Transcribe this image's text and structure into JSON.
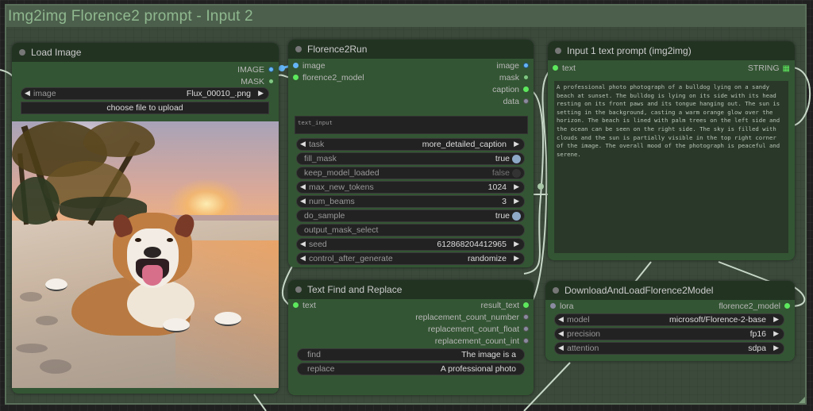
{
  "group": {
    "title": "Img2img Florence2 prompt - Input 2"
  },
  "colors": {
    "node_bg": "#335533",
    "node_header": "#223322",
    "group_bg": "#3b4a3b",
    "group_title": "#8fb88f",
    "slot_image": "#64b5f6",
    "slot_mask": "#81c784",
    "slot_string": "#5de85d",
    "slot_other": "#8a8aa0",
    "wire": "#c8d8c8"
  },
  "load_image": {
    "title": "Load Image",
    "outputs": [
      {
        "name": "IMAGE",
        "type": "image"
      },
      {
        "name": "MASK",
        "type": "mask"
      }
    ],
    "image_widget": {
      "label": "image",
      "value": "Flux_00010_.png"
    },
    "upload_button": "choose file to upload",
    "preview_alt": "bulldog lying on sandy beach at sunset with palm trees"
  },
  "florence2run": {
    "title": "Florence2Run",
    "inputs": [
      {
        "name": "image",
        "type": "image"
      },
      {
        "name": "florence2_model",
        "type": "string"
      }
    ],
    "outputs": [
      {
        "name": "image",
        "type": "image"
      },
      {
        "name": "mask",
        "type": "mask"
      },
      {
        "name": "caption",
        "type": "string"
      },
      {
        "name": "data",
        "type": "other"
      }
    ],
    "text_input_placeholder": "text_input",
    "widgets": {
      "task": {
        "label": "task",
        "value": "more_detailed_caption"
      },
      "fill_mask": {
        "label": "fill_mask",
        "value": "true"
      },
      "keep_model_loaded": {
        "label": "keep_model_loaded",
        "value": "false"
      },
      "max_new_tokens": {
        "label": "max_new_tokens",
        "value": "1024"
      },
      "num_beams": {
        "label": "num_beams",
        "value": "3"
      },
      "do_sample": {
        "label": "do_sample",
        "value": "true"
      },
      "output_mask_select": {
        "label": "output_mask_select",
        "value": ""
      },
      "seed": {
        "label": "seed",
        "value": "612868204412965"
      },
      "control_after_generate": {
        "label": "control_after_generate",
        "value": "randomize"
      }
    }
  },
  "text_prompt": {
    "title": "Input 1 text prompt (img2img)",
    "input": {
      "name": "text",
      "type": "string"
    },
    "output": {
      "name": "STRING",
      "type": "string"
    },
    "text": "A professional photo photograph of a bulldog lying on a sandy beach at sunset. The bulldog is lying on its side with its head resting on its front paws and its tongue hanging out. The sun is setting in the background, casting a warm orange glow over the horizon. The beach is lined with palm trees on the left side and the ocean can be seen on the right side. The sky is filled with clouds and the sun is partially visible in the top right corner of the image. The overall mood of the photograph is peaceful and serene."
  },
  "find_replace": {
    "title": "Text Find and Replace",
    "input": {
      "name": "text",
      "type": "string"
    },
    "outputs": [
      {
        "name": "result_text",
        "type": "string"
      },
      {
        "name": "replacement_count_number",
        "type": "other"
      },
      {
        "name": "replacement_count_float",
        "type": "other"
      },
      {
        "name": "replacement_count_int",
        "type": "other"
      }
    ],
    "find": {
      "label": "find",
      "value": "The image is a"
    },
    "replace": {
      "label": "replace",
      "value": "A professional photo"
    }
  },
  "download_model": {
    "title": "DownloadAndLoadFlorence2Model",
    "input": {
      "name": "lora",
      "type": "other"
    },
    "output": {
      "name": "florence2_model",
      "type": "string"
    },
    "model": {
      "label": "model",
      "value": "microsoft/Florence-2-base"
    },
    "precision": {
      "label": "precision",
      "value": "fp16"
    },
    "attention": {
      "label": "attention",
      "value": "sdpa"
    }
  },
  "icons": {
    "arrow_left": "◀",
    "arrow_right": "▶",
    "string_grid": "▦"
  }
}
